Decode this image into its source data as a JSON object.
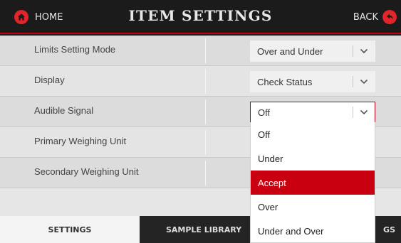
{
  "header": {
    "home_label": "HOME",
    "title": "ITEM SETTINGS",
    "back_label": "BACK",
    "home_icon": "home-icon",
    "back_icon": "back-arrow-icon",
    "accent": "#e2242b"
  },
  "settings": {
    "rows": [
      {
        "label": "Limits Setting Mode",
        "value": "Over and Under"
      },
      {
        "label": "Display",
        "value": "Check Status"
      },
      {
        "label": "Audible Signal",
        "value": "Off"
      },
      {
        "label": "Primary Weighing Unit"
      },
      {
        "label": "Secondary Weighing Unit"
      }
    ]
  },
  "dropdown": {
    "options": [
      "Off",
      "Under",
      "Accept",
      "Over",
      "Under and Over"
    ],
    "highlighted": "Accept",
    "highlight_color": "#c8000f"
  },
  "tabs": {
    "settings": "SETTINGS",
    "sample_library": "SAMPLE LIBRARY",
    "right_partial": "GS"
  }
}
